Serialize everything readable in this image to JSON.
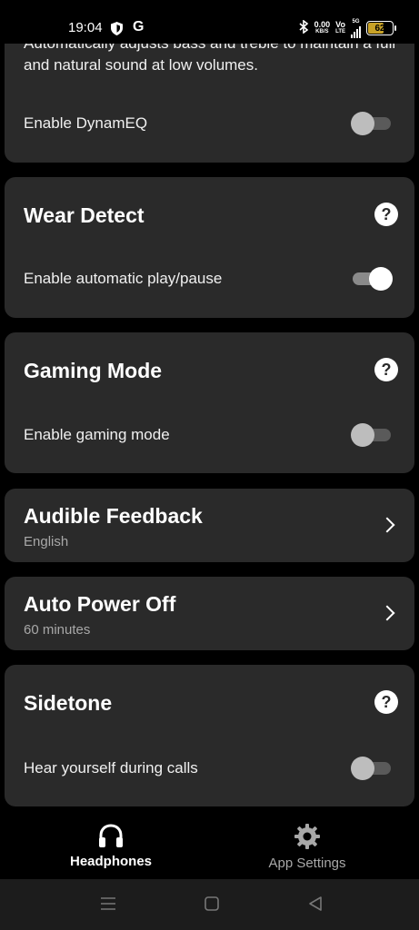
{
  "status_bar": {
    "time": "19:04",
    "g_icon": "G",
    "data_rate": "0.00",
    "data_unit": "KB/S",
    "volte_top": "Vo",
    "volte_bottom": "LTE",
    "network": "5G",
    "battery": "62"
  },
  "dynameq": {
    "description": "Automatically adjusts bass and treble to maintain a full and natural sound at low volumes.",
    "toggle_label": "Enable DynamEQ",
    "enabled": false
  },
  "wear_detect": {
    "title": "Wear Detect",
    "toggle_label": "Enable automatic play/pause",
    "enabled": true
  },
  "gaming_mode": {
    "title": "Gaming Mode",
    "toggle_label": "Enable gaming mode",
    "enabled": false
  },
  "audible_feedback": {
    "title": "Audible Feedback",
    "value": "English"
  },
  "auto_power_off": {
    "title": "Auto Power Off",
    "value": "60 minutes"
  },
  "sidetone": {
    "title": "Sidetone",
    "toggle_label": "Hear yourself during calls",
    "enabled": false
  },
  "help_glyph": "?",
  "bottom_nav": {
    "headphones": "Headphones",
    "app_settings": "App Settings"
  },
  "colors": {
    "background": "#000000",
    "card": "#2a2a2a",
    "subtext": "#a8a8a8"
  }
}
